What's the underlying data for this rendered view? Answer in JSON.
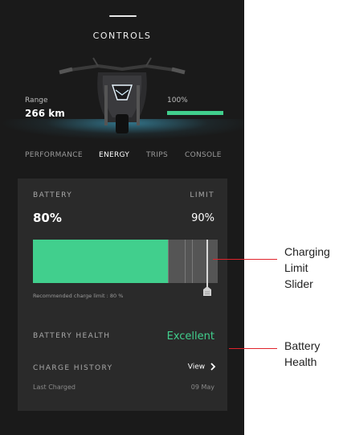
{
  "header": {
    "title": "CONTROLS"
  },
  "vehicle_stats": {
    "range_label": "Range",
    "range_value": "266 km",
    "charge_percent_label": "100%",
    "charge_level": 1.0
  },
  "tabs": [
    {
      "label": "PERFORMANCE",
      "active": false
    },
    {
      "label": "ENERGY",
      "active": true
    },
    {
      "label": "TRIPS",
      "active": false
    },
    {
      "label": "CONSOLE",
      "active": false
    }
  ],
  "battery": {
    "label": "BATTERY",
    "value": "80%",
    "level": 0.8,
    "limit_label": "LIMIT",
    "limit_value": "90%",
    "limit": 0.9,
    "recommendation": "Recommended charge limit : 80 %"
  },
  "health": {
    "label": "BATTERY HEALTH",
    "value": "Excellent"
  },
  "charge_history": {
    "label": "CHARGE HISTORY",
    "view_label": "View",
    "last_charged_label": "Last Charged",
    "last_charged_value": "09 May"
  },
  "annotations": [
    {
      "lines": [
        "Charging",
        "Limit",
        "Slider"
      ]
    },
    {
      "lines": [
        "Battery",
        "Health"
      ]
    }
  ],
  "colors": {
    "accent": "#41cf8d",
    "background": "#1a1a1a",
    "card": "#2a2a2a",
    "annotation_line": "#e0232b"
  }
}
